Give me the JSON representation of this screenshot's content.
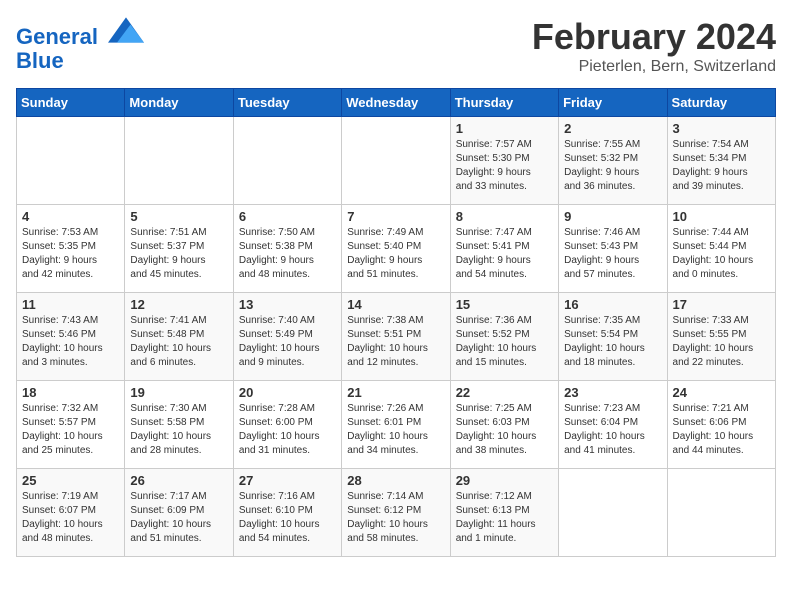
{
  "header": {
    "logo_line1": "General",
    "logo_line2": "Blue",
    "month": "February 2024",
    "location": "Pieterlen, Bern, Switzerland"
  },
  "days_of_week": [
    "Sunday",
    "Monday",
    "Tuesday",
    "Wednesday",
    "Thursday",
    "Friday",
    "Saturday"
  ],
  "weeks": [
    [
      {
        "num": "",
        "info": ""
      },
      {
        "num": "",
        "info": ""
      },
      {
        "num": "",
        "info": ""
      },
      {
        "num": "",
        "info": ""
      },
      {
        "num": "1",
        "info": "Sunrise: 7:57 AM\nSunset: 5:30 PM\nDaylight: 9 hours\nand 33 minutes."
      },
      {
        "num": "2",
        "info": "Sunrise: 7:55 AM\nSunset: 5:32 PM\nDaylight: 9 hours\nand 36 minutes."
      },
      {
        "num": "3",
        "info": "Sunrise: 7:54 AM\nSunset: 5:34 PM\nDaylight: 9 hours\nand 39 minutes."
      }
    ],
    [
      {
        "num": "4",
        "info": "Sunrise: 7:53 AM\nSunset: 5:35 PM\nDaylight: 9 hours\nand 42 minutes."
      },
      {
        "num": "5",
        "info": "Sunrise: 7:51 AM\nSunset: 5:37 PM\nDaylight: 9 hours\nand 45 minutes."
      },
      {
        "num": "6",
        "info": "Sunrise: 7:50 AM\nSunset: 5:38 PM\nDaylight: 9 hours\nand 48 minutes."
      },
      {
        "num": "7",
        "info": "Sunrise: 7:49 AM\nSunset: 5:40 PM\nDaylight: 9 hours\nand 51 minutes."
      },
      {
        "num": "8",
        "info": "Sunrise: 7:47 AM\nSunset: 5:41 PM\nDaylight: 9 hours\nand 54 minutes."
      },
      {
        "num": "9",
        "info": "Sunrise: 7:46 AM\nSunset: 5:43 PM\nDaylight: 9 hours\nand 57 minutes."
      },
      {
        "num": "10",
        "info": "Sunrise: 7:44 AM\nSunset: 5:44 PM\nDaylight: 10 hours\nand 0 minutes."
      }
    ],
    [
      {
        "num": "11",
        "info": "Sunrise: 7:43 AM\nSunset: 5:46 PM\nDaylight: 10 hours\nand 3 minutes."
      },
      {
        "num": "12",
        "info": "Sunrise: 7:41 AM\nSunset: 5:48 PM\nDaylight: 10 hours\nand 6 minutes."
      },
      {
        "num": "13",
        "info": "Sunrise: 7:40 AM\nSunset: 5:49 PM\nDaylight: 10 hours\nand 9 minutes."
      },
      {
        "num": "14",
        "info": "Sunrise: 7:38 AM\nSunset: 5:51 PM\nDaylight: 10 hours\nand 12 minutes."
      },
      {
        "num": "15",
        "info": "Sunrise: 7:36 AM\nSunset: 5:52 PM\nDaylight: 10 hours\nand 15 minutes."
      },
      {
        "num": "16",
        "info": "Sunrise: 7:35 AM\nSunset: 5:54 PM\nDaylight: 10 hours\nand 18 minutes."
      },
      {
        "num": "17",
        "info": "Sunrise: 7:33 AM\nSunset: 5:55 PM\nDaylight: 10 hours\nand 22 minutes."
      }
    ],
    [
      {
        "num": "18",
        "info": "Sunrise: 7:32 AM\nSunset: 5:57 PM\nDaylight: 10 hours\nand 25 minutes."
      },
      {
        "num": "19",
        "info": "Sunrise: 7:30 AM\nSunset: 5:58 PM\nDaylight: 10 hours\nand 28 minutes."
      },
      {
        "num": "20",
        "info": "Sunrise: 7:28 AM\nSunset: 6:00 PM\nDaylight: 10 hours\nand 31 minutes."
      },
      {
        "num": "21",
        "info": "Sunrise: 7:26 AM\nSunset: 6:01 PM\nDaylight: 10 hours\nand 34 minutes."
      },
      {
        "num": "22",
        "info": "Sunrise: 7:25 AM\nSunset: 6:03 PM\nDaylight: 10 hours\nand 38 minutes."
      },
      {
        "num": "23",
        "info": "Sunrise: 7:23 AM\nSunset: 6:04 PM\nDaylight: 10 hours\nand 41 minutes."
      },
      {
        "num": "24",
        "info": "Sunrise: 7:21 AM\nSunset: 6:06 PM\nDaylight: 10 hours\nand 44 minutes."
      }
    ],
    [
      {
        "num": "25",
        "info": "Sunrise: 7:19 AM\nSunset: 6:07 PM\nDaylight: 10 hours\nand 48 minutes."
      },
      {
        "num": "26",
        "info": "Sunrise: 7:17 AM\nSunset: 6:09 PM\nDaylight: 10 hours\nand 51 minutes."
      },
      {
        "num": "27",
        "info": "Sunrise: 7:16 AM\nSunset: 6:10 PM\nDaylight: 10 hours\nand 54 minutes."
      },
      {
        "num": "28",
        "info": "Sunrise: 7:14 AM\nSunset: 6:12 PM\nDaylight: 10 hours\nand 58 minutes."
      },
      {
        "num": "29",
        "info": "Sunrise: 7:12 AM\nSunset: 6:13 PM\nDaylight: 11 hours\nand 1 minute."
      },
      {
        "num": "",
        "info": ""
      },
      {
        "num": "",
        "info": ""
      }
    ]
  ]
}
